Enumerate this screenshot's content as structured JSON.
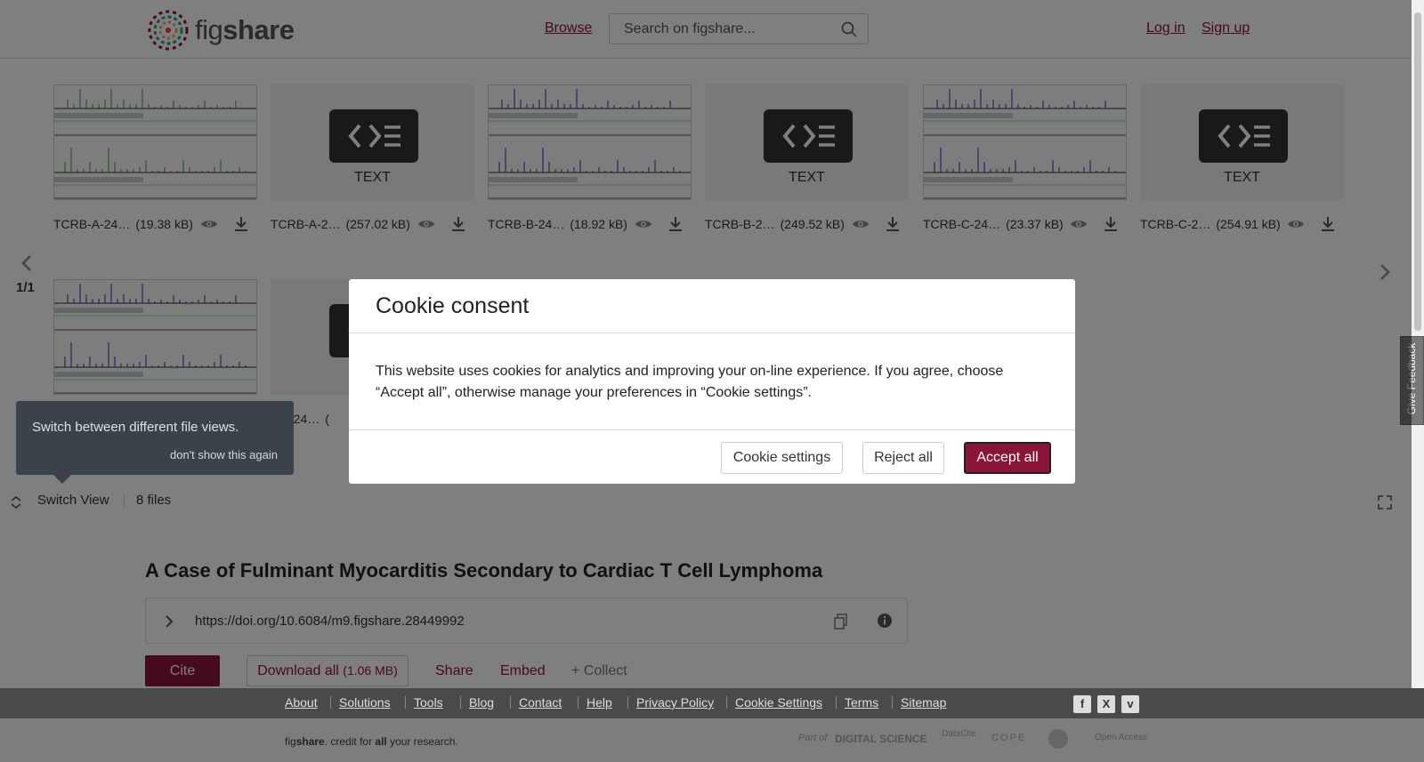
{
  "header": {
    "logo_text_a": "fig",
    "logo_text_b": "share",
    "browse": "Browse",
    "search_placeholder": "Search on figshare...",
    "login": "Log in",
    "signup": "Sign up"
  },
  "files": [
    {
      "name": "TCRB-A-24…",
      "size": "(19.38 kB)",
      "kind": "chart",
      "color": "#3a9a3a"
    },
    {
      "name": "TCRB-A-2…",
      "size": "(257.02 kB)",
      "kind": "text",
      "text_label": "TEXT"
    },
    {
      "name": "TCRB-B-24…",
      "size": "(18.92 kB)",
      "kind": "chart",
      "color": "#2a2aa8"
    },
    {
      "name": "TCRB-B-2…",
      "size": "(249.52 kB)",
      "kind": "text",
      "text_label": "TEXT"
    },
    {
      "name": "TCRB-C-24…",
      "size": "(23.37 kB)",
      "kind": "chart",
      "color": "#2a2aa8"
    },
    {
      "name": "TCRB-C-2…",
      "size": "(254.91 kB)",
      "kind": "text",
      "text_label": "TEXT"
    },
    {
      "name": "",
      "size": "",
      "kind": "chart",
      "color": "#2a2aa8"
    },
    {
      "name": "RG-24…",
      "size": "(",
      "kind": "text",
      "text_label": ""
    }
  ],
  "viewer": {
    "page_indicator": "1/1",
    "switch_view": "Switch View",
    "file_count": "8 files"
  },
  "tooltip": {
    "text": "Switch between different file views.",
    "dismiss": "don't show this again"
  },
  "cookie": {
    "title": "Cookie consent",
    "body": "This website uses cookies for analytics and improving your on-line experience. If you agree, choose “Accept all”, otherwise manage your preferences in “Cookie settings”.",
    "settings": "Cookie settings",
    "reject": "Reject all",
    "accept": "Accept all"
  },
  "article": {
    "title": "A Case of Fulminant Myocarditis Secondary to Cardiac T Cell Lymphoma",
    "doi": "https://doi.org/10.6084/m9.figshare.28449992",
    "cite": "Cite",
    "download_all": "Download all",
    "download_size": "(1.06 MB)",
    "share": "Share",
    "embed": "Embed",
    "collect": "+ Collect"
  },
  "footer": {
    "links": [
      "About",
      "Solutions",
      "Tools",
      "Blog",
      "Contact",
      "Help",
      "Privacy Policy",
      "Cookie Settings",
      "Terms",
      "Sitemap"
    ],
    "tagline_a": "fig",
    "tagline_b": "share",
    "tagline_c": ". credit for ",
    "tagline_d": "all",
    "tagline_e": " your research.",
    "part_of": "Part of",
    "digital_science": "DIGITAL SCIENCE",
    "datacite": "DataCite",
    "cope": "COPE",
    "open_access": "Open Access",
    "social": [
      "f",
      "X",
      "v"
    ]
  },
  "feedback": "Give Feedback",
  "colors": {
    "brand": "#8a1538",
    "overlay": "rgba(0,0,0,0.5)"
  }
}
